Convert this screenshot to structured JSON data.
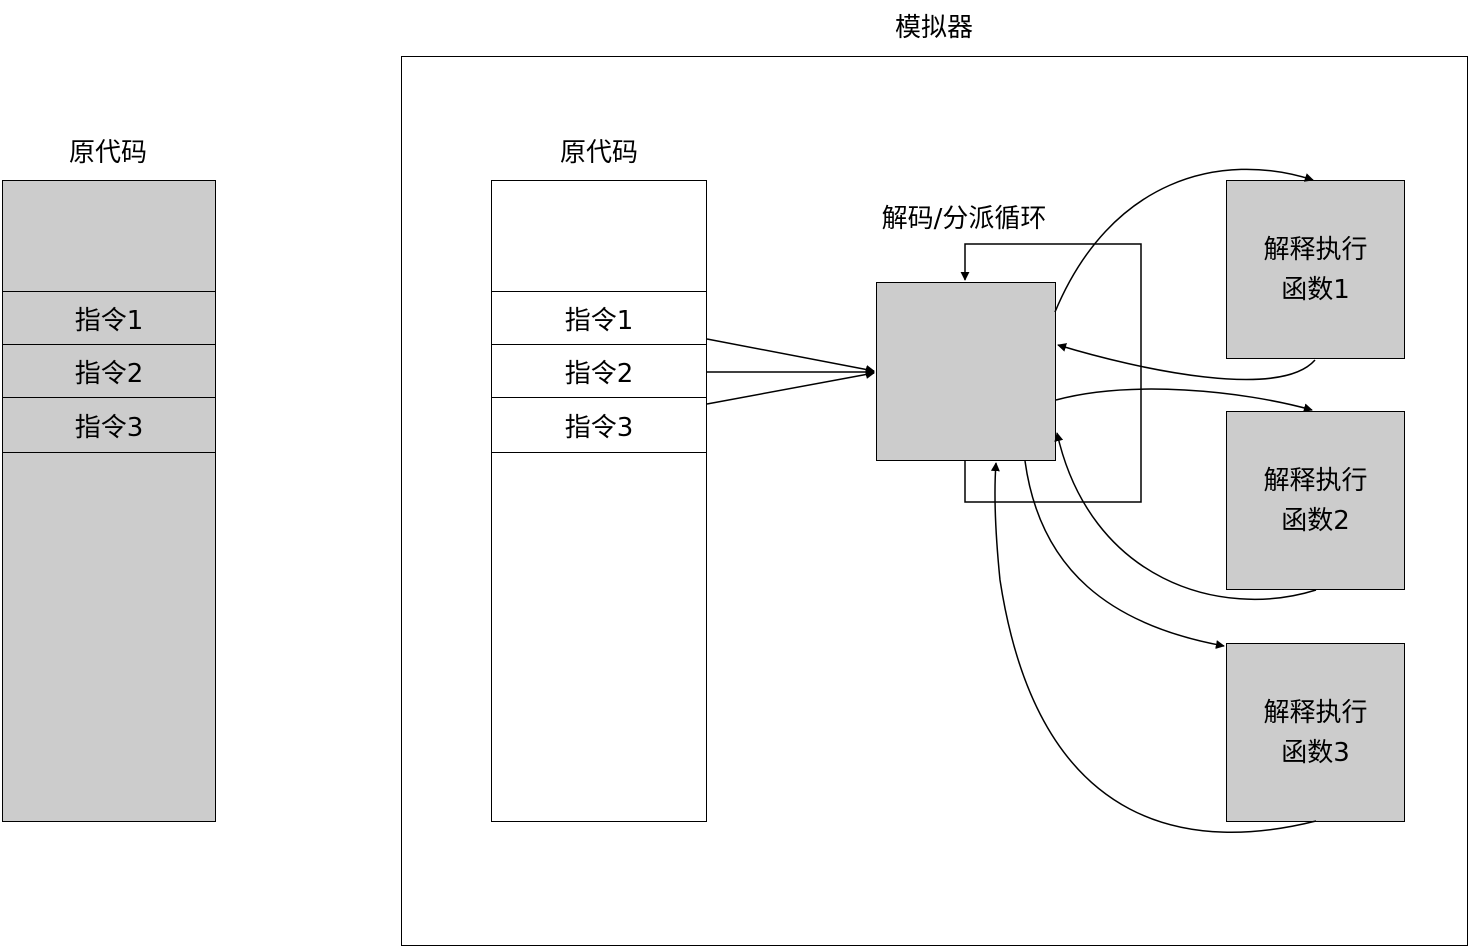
{
  "left_column": {
    "title": "原代码",
    "instructions": [
      "指令1",
      "指令2",
      "指令3"
    ]
  },
  "emulator": {
    "title": "模拟器",
    "source": {
      "title": "原代码",
      "instructions": [
        "指令1",
        "指令2",
        "指令3"
      ]
    },
    "dispatcher": {
      "label": "解码/分派循环"
    },
    "functions": [
      {
        "line1": "解释执行",
        "line2": "函数1"
      },
      {
        "line1": "解释执行",
        "line2": "函数2"
      },
      {
        "line1": "解释执行",
        "line2": "函数3"
      }
    ]
  },
  "colors": {
    "fill_gray": "#cccccc",
    "stroke": "#000000",
    "background": "#ffffff"
  }
}
